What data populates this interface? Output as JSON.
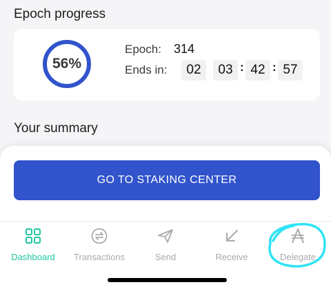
{
  "epoch_progress": {
    "title": "Epoch progress",
    "percent_label": "56%",
    "progress_fraction": 0.56,
    "epoch_label": "Epoch:",
    "epoch_value": "314",
    "ends_in_label": "Ends in:",
    "countdown": [
      "02",
      "03",
      "42",
      "57"
    ]
  },
  "summary": {
    "title": "Your summary"
  },
  "actions": {
    "staking_button_label": "GO TO STAKING CENTER"
  },
  "tab_bar": {
    "tabs": [
      {
        "label": "Dashboard",
        "icon": "dashboard-icon",
        "active": true
      },
      {
        "label": "Transactions",
        "icon": "transactions-icon",
        "active": false
      },
      {
        "label": "Send",
        "icon": "send-icon",
        "active": false
      },
      {
        "label": "Receive",
        "icon": "receive-icon",
        "active": false
      },
      {
        "label": "Delegate",
        "icon": "ada-icon",
        "active": false
      }
    ]
  },
  "colors": {
    "accent_blue": "#3154cc",
    "active_tab": "#1fc6a0",
    "inactive_tab": "#a9a9ae",
    "highlight_annotation": "#2fe3f5"
  }
}
